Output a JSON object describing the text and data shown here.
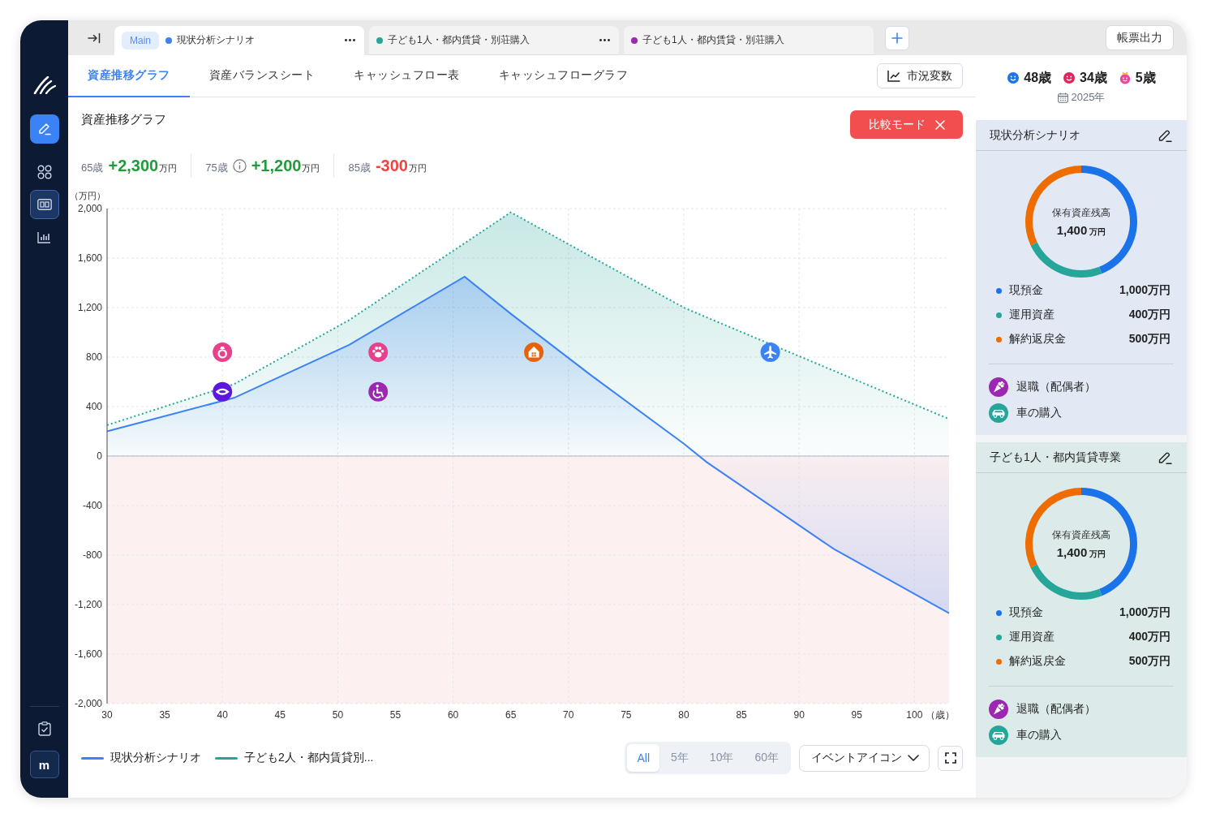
{
  "sidebar": {
    "nav_items": [
      {
        "selected": false
      },
      {
        "selected": true
      },
      {
        "selected": false
      }
    ],
    "user_initial": "m"
  },
  "tab_bar": {
    "tabs": [
      {
        "badge": "Main",
        "label": "現状分析シナリオ",
        "color": "#3b82f6",
        "selected": true,
        "menu": true
      },
      {
        "label": "子ども1人・都内賃貸・別荘購入",
        "color": "#26a69a",
        "selected": false,
        "menu": true
      },
      {
        "label": "子ども1人・都内賃貸・別荘購入",
        "color": "#9c27b0",
        "selected": false,
        "menu": false
      }
    ],
    "export_button": "帳票出力"
  },
  "view_tabs": [
    {
      "label": "資産推移グラフ",
      "selected": true
    },
    {
      "label": "資産バランスシート",
      "selected": false
    },
    {
      "label": "キャッシュフロー表",
      "selected": false
    },
    {
      "label": "キャッシュフローグラフ",
      "selected": false
    }
  ],
  "market_button": "市況変数",
  "asset_chart": {
    "title": "資産推移グラフ",
    "compare_button": "比較モード",
    "milestones": [
      {
        "age": "65歳",
        "value": "+2,300",
        "unit": "万円",
        "kind": "gain",
        "info": false
      },
      {
        "age": "75歳",
        "value": "+1,200",
        "unit": "万円",
        "kind": "gain",
        "info": true
      },
      {
        "age": "85歳",
        "value": "-300",
        "unit": "万円",
        "kind": "loss",
        "info": false
      }
    ],
    "chart_data": {
      "type": "area",
      "xlabel": "（歳）",
      "ylabel": "（万円）",
      "grid": true,
      "x": [
        30,
        41,
        51,
        61,
        65,
        72,
        80,
        82,
        93,
        103
      ],
      "xlim": [
        30,
        103
      ],
      "ylim": [
        -2000,
        2000
      ],
      "xticks": [
        30,
        35,
        40,
        45,
        50,
        55,
        60,
        65,
        70,
        75,
        80,
        85,
        90,
        95,
        100
      ],
      "yticks": [
        {
          "value": -2000,
          "label": "-2,000"
        },
        {
          "value": -1600,
          "label": "-1,600"
        },
        {
          "value": -1200,
          "label": "-1,200"
        },
        -800,
        -400,
        0,
        400,
        800,
        {
          "value": 1200,
          "label": "1,200"
        },
        {
          "value": 1600,
          "label": "1,600"
        },
        {
          "value": 2000,
          "label": "2,000"
        }
      ],
      "series": [
        {
          "name": "現状分析シナリオ",
          "color": "#3b82f6",
          "values": [
            200,
            470,
            900,
            1450,
            1150,
            650,
            100,
            -50,
            -750,
            -1270
          ]
        },
        {
          "name": "子ども2人・都内賃貸別...",
          "color": "#26a69a",
          "values": [
            250,
            580,
            1100,
            1720,
            1970,
            1610,
            1200,
            1120,
            690,
            300
          ]
        }
      ]
    },
    "series_lines": [
      {
        "dotted": false
      },
      {
        "dotted": true
      }
    ],
    "event_markers": [
      {
        "kind": "ring",
        "color": "#e8418c"
      },
      {
        "kind": "eye",
        "color": "#5b16e0"
      },
      {
        "kind": "paw",
        "color": "#e8418c"
      },
      {
        "kind": "wheelchair",
        "color": "#9c27b0"
      },
      {
        "kind": "house",
        "color": "#e8620c"
      },
      {
        "kind": "plane",
        "color": "#3b82f6"
      }
    ],
    "range_options": [
      {
        "label": "All",
        "selected": true
      },
      {
        "label": "5年",
        "selected": false
      },
      {
        "label": "10年",
        "selected": false
      },
      {
        "label": "60年",
        "selected": false
      }
    ],
    "event_dropdown": "イベントアイコン"
  },
  "household": {
    "members": [
      {
        "age": "48歳",
        "kind": "adult",
        "color": "#1a73e8"
      },
      {
        "age": "34歳",
        "kind": "adult",
        "color": "#e0245e"
      },
      {
        "age": "5歳",
        "kind": "child",
        "color": "#ec4899"
      }
    ],
    "year": "2025年"
  },
  "scenario_cards": [
    {
      "title": "現状分析シナリオ",
      "color": "#e2e8f4",
      "chart_data": {
        "type": "donut",
        "title": "保有資産残高",
        "categories": [
          "現預金",
          "運用資産",
          "解約返戻金"
        ],
        "values": [
          44,
          24,
          32
        ],
        "colors": [
          "#1a73e8",
          "#26a69a",
          "#ef6c00"
        ]
      },
      "total": "1,400",
      "total_unit": "万円",
      "amounts": [
        "1,000万円",
        "400万円",
        "500万円"
      ],
      "events": [
        {
          "label": "退職（配偶者）",
          "kind": "retirement",
          "color": "#9c27b0"
        },
        {
          "label": "車の購入",
          "kind": "car",
          "color": "#26a69a"
        }
      ]
    },
    {
      "title": "子ども1人・都内賃貸専業",
      "color": "#dcebe9",
      "chart_data": {
        "type": "donut",
        "title": "保有資産残高",
        "categories": [
          "現預金",
          "運用資産",
          "解約返戻金"
        ],
        "values": [
          44,
          24,
          32
        ],
        "colors": [
          "#1a73e8",
          "#26a69a",
          "#ef6c00"
        ]
      },
      "total": "1,400",
      "total_unit": "万円",
      "amounts": [
        "1,000万円",
        "400万円",
        "500万円"
      ],
      "events": [
        {
          "label": "退職（配偶者）",
          "kind": "retirement",
          "color": "#9c27b0"
        },
        {
          "label": "車の購入",
          "kind": "car",
          "color": "#26a69a"
        }
      ]
    }
  ]
}
